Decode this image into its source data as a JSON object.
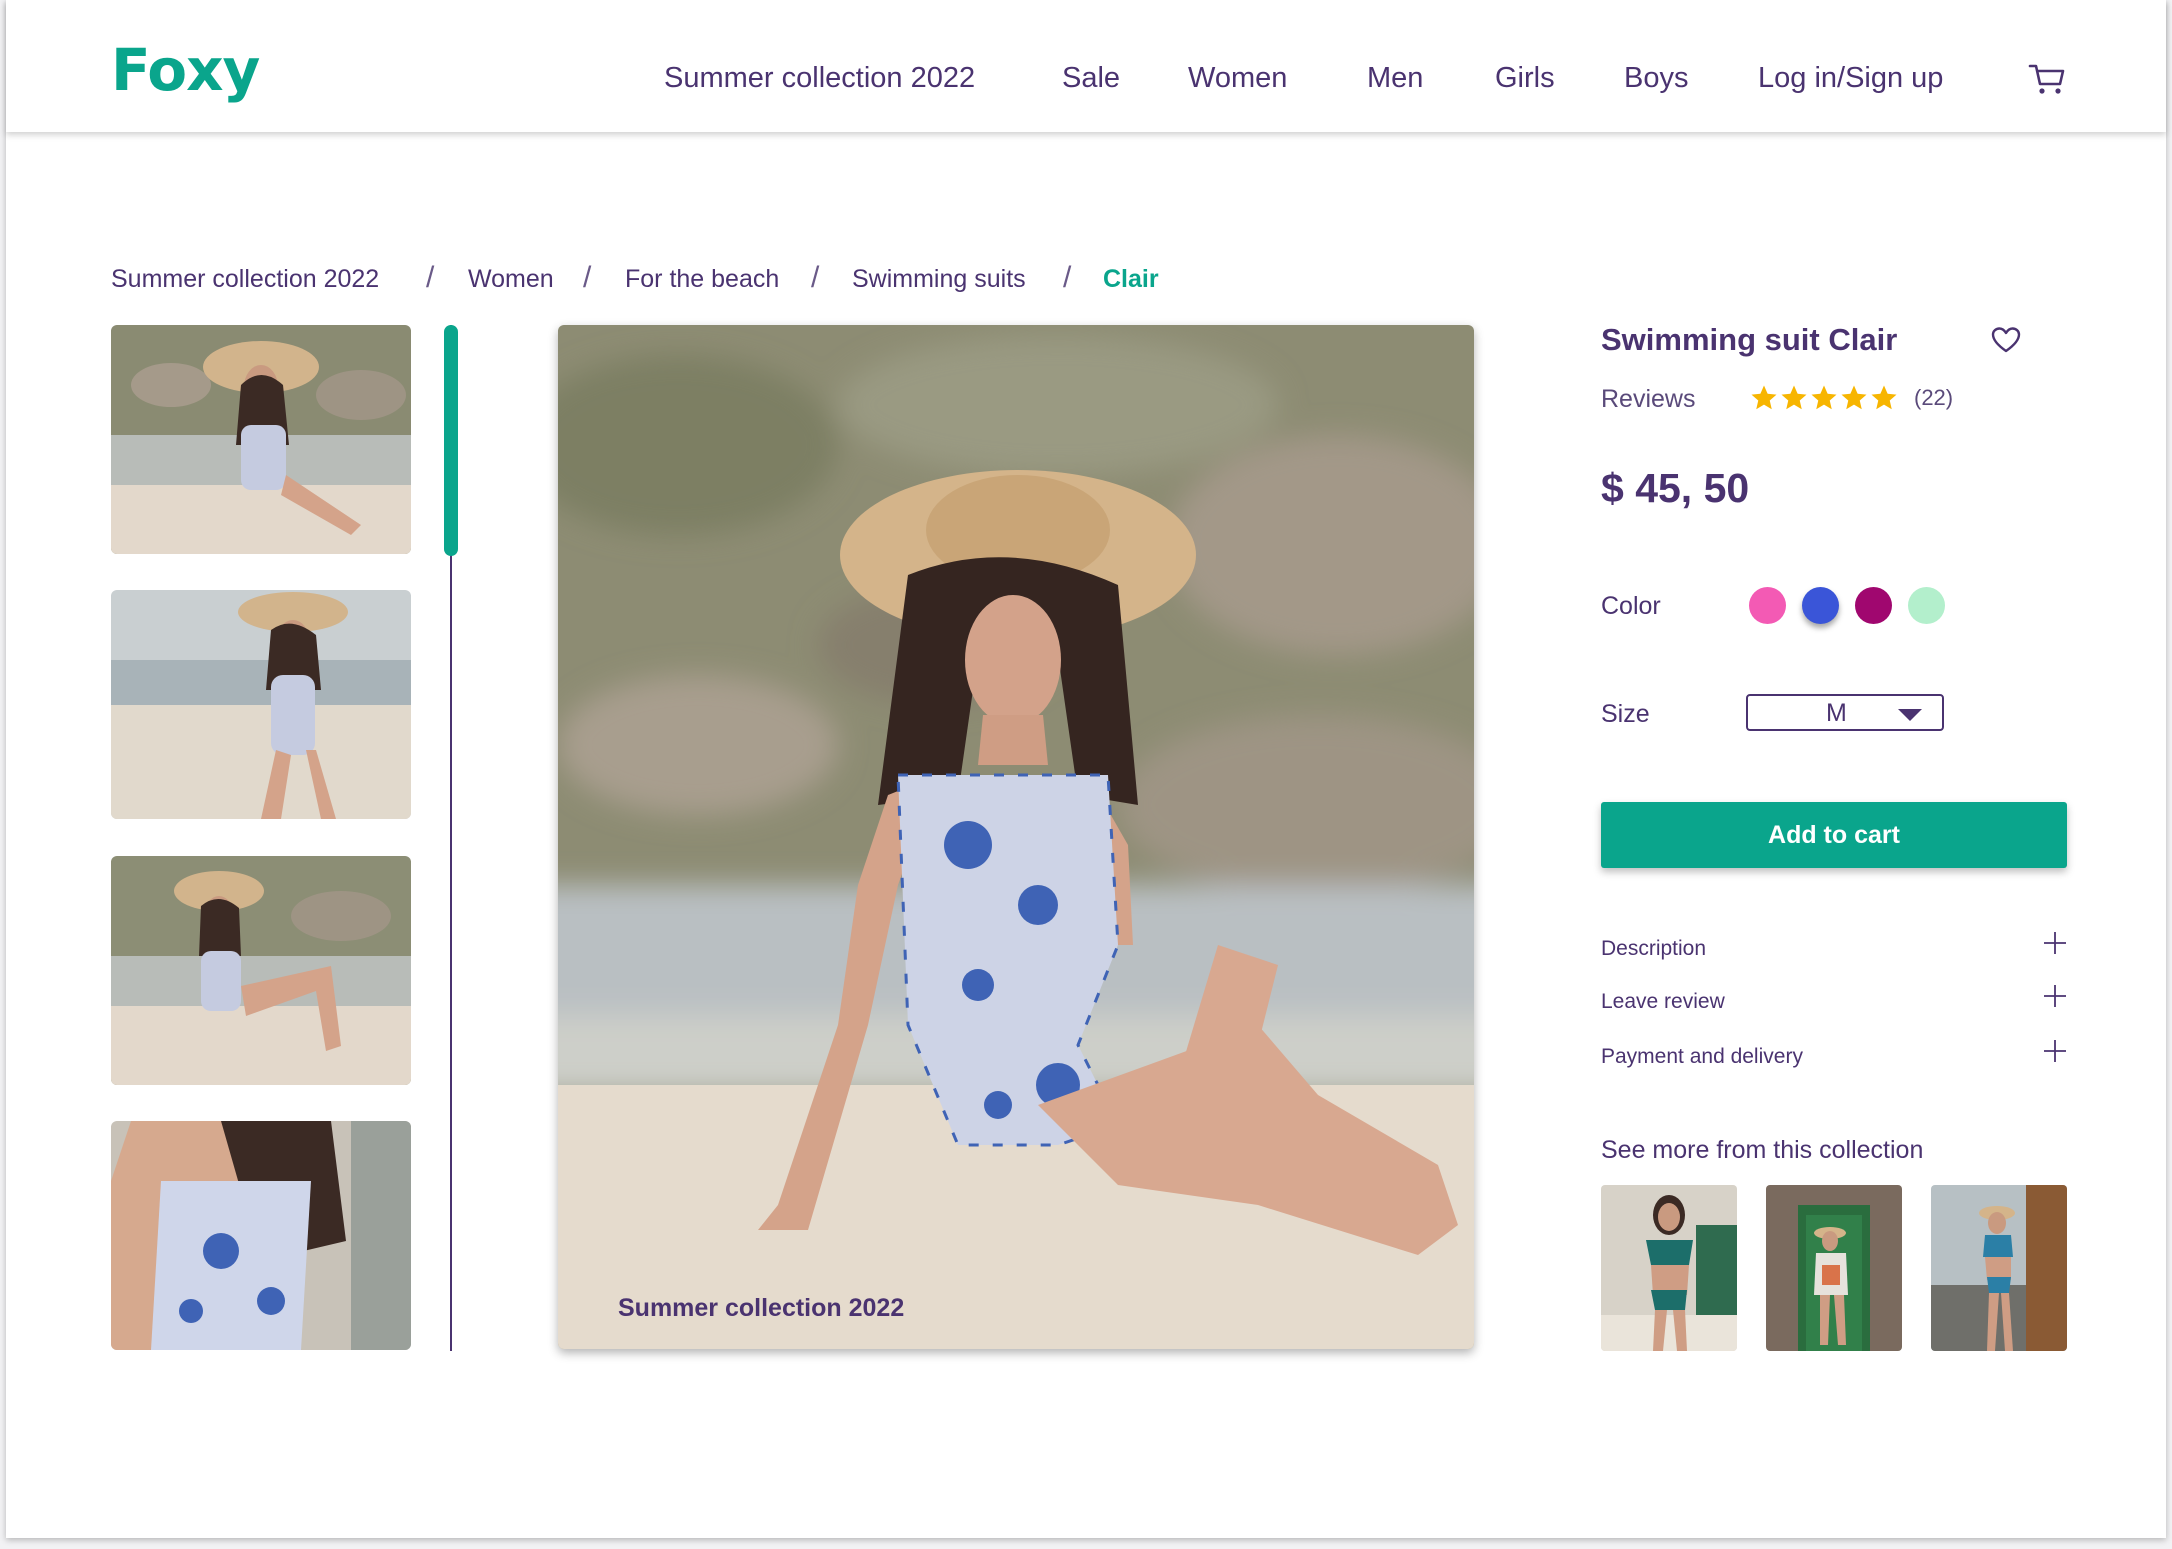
{
  "header": {
    "logo": "Foxy",
    "nav": [
      "Summer collection 2022",
      "Sale",
      "Women",
      "Men",
      "Girls",
      "Boys",
      "Log in/Sign up"
    ]
  },
  "breadcrumb": [
    "Summer collection 2022",
    "Women",
    "For the beach",
    "Swimming suits",
    "Clair"
  ],
  "gallery": {
    "main_caption": "Summer collection 2022"
  },
  "product": {
    "title": "Swimming suit Clair",
    "reviews_label": "Reviews",
    "rating": 5,
    "review_count": "(22)",
    "price": "$ 45, 50",
    "color_label": "Color",
    "colors": [
      "#f35ab4",
      "#3a55d8",
      "#a0076f",
      "#b3efcc"
    ],
    "selected_color": 1,
    "size_label": "Size",
    "size_value": "M",
    "add_to_cart": "Add to cart",
    "accordion": [
      "Description",
      "Leave review",
      "Payment and delivery"
    ],
    "see_more": "See more from this collection"
  },
  "theme": {
    "accent": "#0aa58c",
    "text": "#4a3370",
    "star": "#f7b500"
  }
}
